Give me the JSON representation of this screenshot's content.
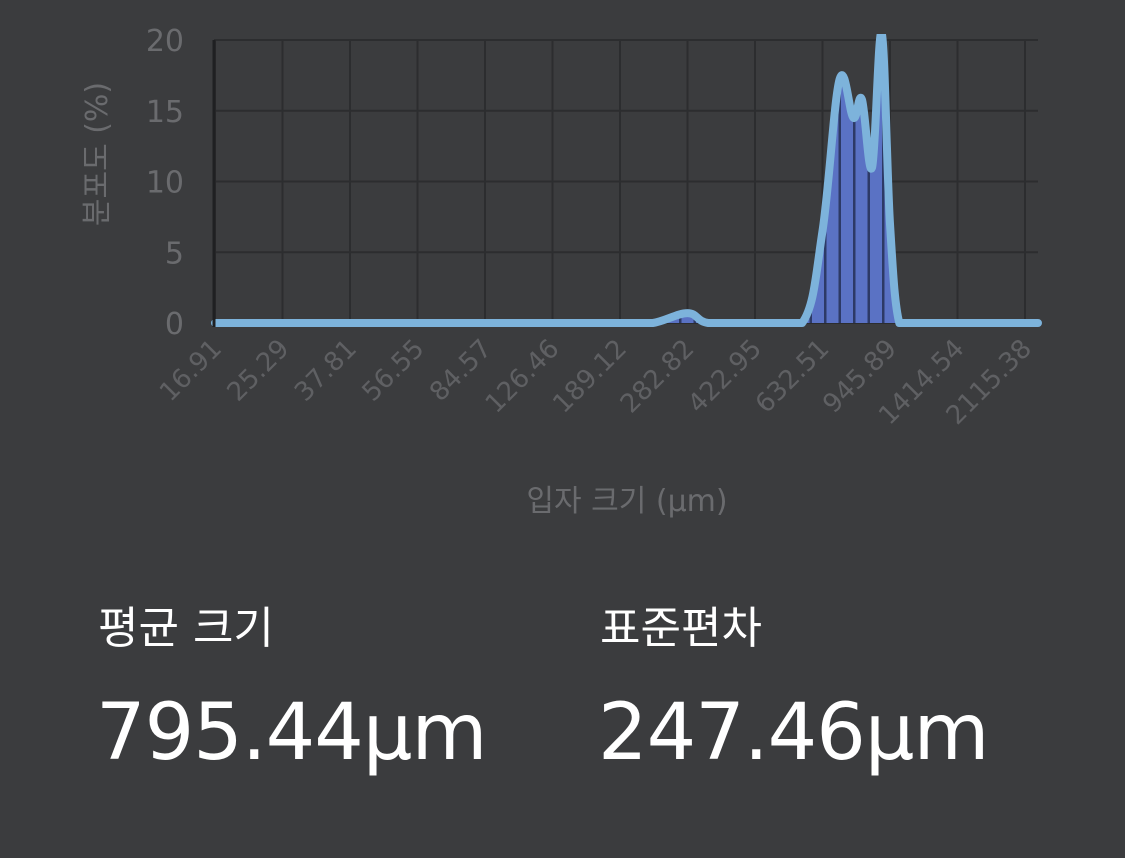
{
  "chart_data": {
    "type": "line",
    "xlabel": "입자 크기 (μm)",
    "ylabel": "분포도 (%)",
    "ylim": [
      0,
      20
    ],
    "yticks": [
      0,
      5,
      10,
      15,
      20
    ],
    "grid": true,
    "x_tick_labels": [
      "16.91",
      "25.29",
      "37.81",
      "56.55",
      "84.57",
      "126.46",
      "189.12",
      "282.82",
      "422.95",
      "632.51",
      "945.89",
      "1414.54",
      "2115.38"
    ],
    "series": [
      {
        "line_color": "#7db3db",
        "fill_color": "#5a72c4",
        "x": [
          16.91,
          25.29,
          37.81,
          56.55,
          84.57,
          126.46,
          189.12,
          230,
          282.82,
          320,
          422.95,
          560,
          632.51,
          700,
          760,
          800,
          850,
          900,
          945.89,
          1000,
          1100,
          1200,
          1300,
          1414.54,
          2115.38,
          3000
        ],
        "values": [
          0,
          0,
          0,
          0,
          0,
          0,
          0,
          0,
          0.7,
          0,
          0,
          0,
          6.5,
          17.2,
          14.5,
          15.8,
          11,
          20.5,
          7,
          0,
          0,
          0,
          0,
          0,
          0,
          0
        ]
      }
    ]
  },
  "stats": {
    "mean_label": "평균 크기",
    "mean_value": "795.44μm",
    "std_label": "표준편차",
    "std_value": "247.46μm"
  }
}
